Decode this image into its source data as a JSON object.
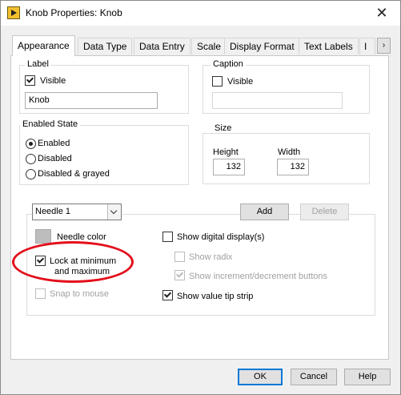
{
  "window": {
    "title": "Knob Properties: Knob",
    "close_glyph": "✕"
  },
  "tabs": [
    {
      "label": "Appearance"
    },
    {
      "label": "Data Type"
    },
    {
      "label": "Data Entry"
    },
    {
      "label": "Scale"
    },
    {
      "label": "Display Format"
    },
    {
      "label": "Text Labels"
    },
    {
      "label": "I"
    }
  ],
  "label_group": {
    "title": "Label",
    "visible_label": "Visible",
    "visible_checked": true,
    "value": "Knob"
  },
  "caption_group": {
    "title": "Caption",
    "visible_label": "Visible",
    "visible_checked": false,
    "value": ""
  },
  "enabled_state": {
    "title": "Enabled State",
    "options": [
      "Enabled",
      "Disabled",
      "Disabled & grayed"
    ],
    "selected": "Enabled"
  },
  "size_group": {
    "title": "Size",
    "height_label": "Height",
    "height_value": "132",
    "width_label": "Width",
    "width_value": "132"
  },
  "needle": {
    "dropdown_value": "Needle 1",
    "add_label": "Add",
    "delete_label": "Delete",
    "color_label": "Needle color",
    "lock_label_line1": "Lock at minimum",
    "lock_label_line2": "and maximum",
    "lock_checked": true,
    "snap_label": "Snap to mouse",
    "snap_checked": false
  },
  "digital": {
    "show_digital_label": "Show digital display(s)",
    "show_digital_checked": false,
    "show_radix_label": "Show radix",
    "show_radix_checked": false,
    "show_incdec_label": "Show increment/decrement buttons",
    "show_incdec_checked": true,
    "show_tip_label": "Show value tip strip",
    "show_tip_checked": true
  },
  "footer": {
    "ok_label": "OK",
    "cancel_label": "Cancel",
    "help_label": "Help"
  },
  "colors": {
    "annotation": "#e30f1b",
    "default_button_border": "#0078d7"
  }
}
